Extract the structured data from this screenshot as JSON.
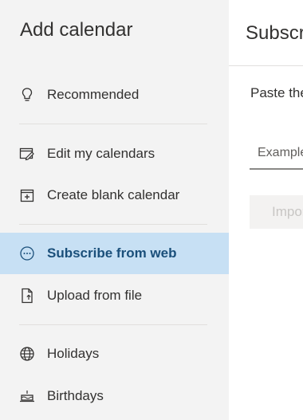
{
  "sidebar": {
    "title": "Add calendar",
    "items": [
      {
        "label": "Recommended",
        "icon": "lightbulb-icon"
      },
      {
        "label": "Edit my calendars",
        "icon": "edit-calendar-icon"
      },
      {
        "label": "Create blank calendar",
        "icon": "add-calendar-icon"
      },
      {
        "label": "Subscribe from web",
        "icon": "subscribe-web-icon",
        "selected": true
      },
      {
        "label": "Upload from file",
        "icon": "upload-file-icon"
      },
      {
        "label": "Holidays",
        "icon": "globe-icon"
      },
      {
        "label": "Birthdays",
        "icon": "birthday-cake-icon"
      }
    ]
  },
  "main": {
    "title": "Subscribe from web",
    "instruction": "Paste the",
    "url_placeholder": "Example",
    "import_label": "Import"
  },
  "colors": {
    "sidebar_bg": "#f3f3f3",
    "selected_bg": "#c7e0f4",
    "selected_text": "#1a4f7a"
  }
}
